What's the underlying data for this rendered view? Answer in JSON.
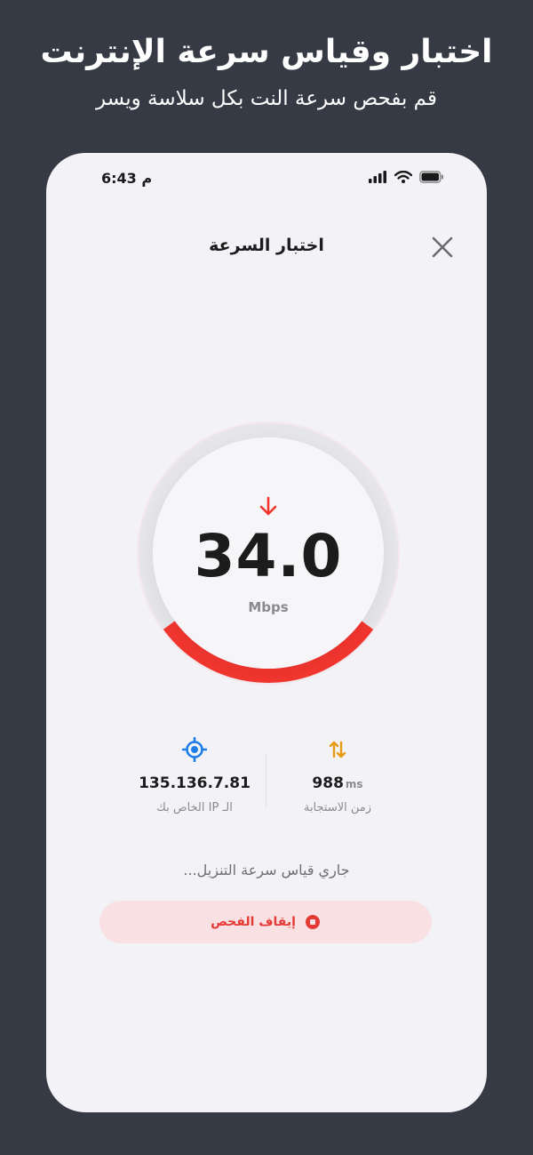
{
  "promo": {
    "title": "اختبار وقياس سرعة الإنترنت",
    "subtitle": "قم بفحص سرعة النت بكل سلاسة ويسر"
  },
  "status_bar": {
    "time": "6:43 م",
    "icons": [
      "signal-icon",
      "wifi-icon",
      "battery-icon"
    ]
  },
  "header": {
    "title": "اختبار السرعة",
    "close_icon": "close-icon"
  },
  "gauge": {
    "value": "34.0",
    "unit": "Mbps",
    "direction_icon": "download-arrow-icon",
    "progress_fraction": 0.3,
    "accent_color": "#f2362f"
  },
  "stats": {
    "ip": {
      "icon": "location-target-icon",
      "value": "135.136.7.81",
      "label": "الـ IP الخاص بك"
    },
    "ping": {
      "icon": "up-down-arrows-icon",
      "value": "988",
      "unit": "ms",
      "label": "زمن الاستجابة"
    }
  },
  "progress_text": "جاري قياس سرعة التنزيل...",
  "stop_button": {
    "label": "إيقاف الفحص",
    "icon": "stop-icon",
    "color": "#e53935"
  }
}
